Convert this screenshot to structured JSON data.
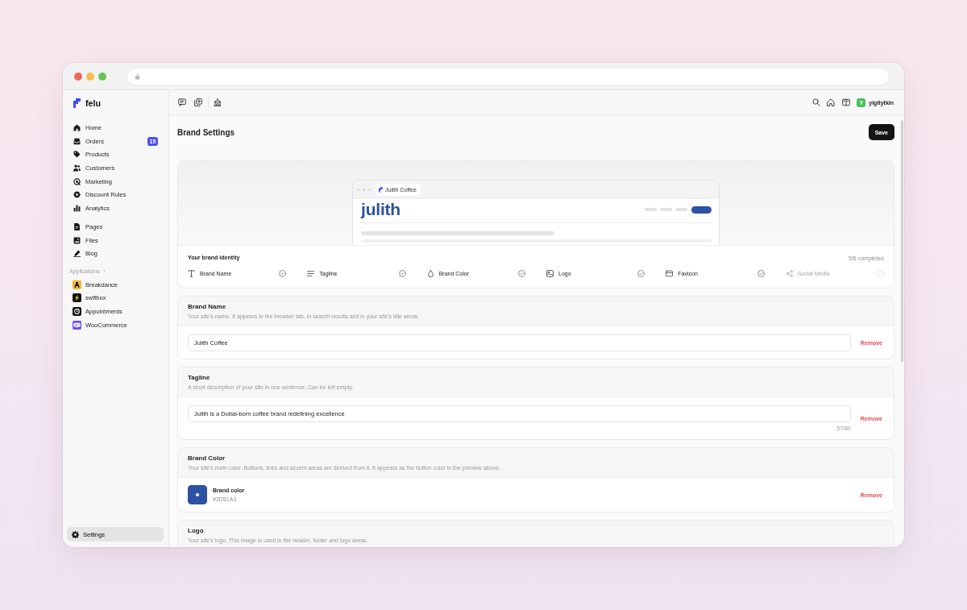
{
  "sidebar": {
    "brand": "felu",
    "primary_items": [
      {
        "label": "Home",
        "selected": false
      },
      {
        "label": "Orders",
        "badge": "15",
        "selected": false
      },
      {
        "label": "Products",
        "selected": false
      },
      {
        "label": "Customers",
        "selected": false
      },
      {
        "label": "Marketing",
        "selected": false
      },
      {
        "label": "Discount Rules",
        "selected": false
      },
      {
        "label": "Analytics",
        "selected": false
      }
    ],
    "content_items": [
      {
        "label": "Pages",
        "selected": false
      },
      {
        "label": "Files",
        "selected": false
      },
      {
        "label": "Blog",
        "selected": false
      }
    ],
    "applications": {
      "heading": "Applications",
      "items": [
        {
          "label": "Breakdance",
          "selected": false
        },
        {
          "label": "swftbox",
          "selected": false
        },
        {
          "label": "Appointments",
          "selected": false
        },
        {
          "label": "WooCommerce",
          "selected": false
        }
      ]
    },
    "footer_item": {
      "label": "Settings",
      "selected": true
    }
  },
  "topbar": {
    "user": {
      "initial": "Y",
      "name": "yigitytkin"
    }
  },
  "page": {
    "title": "Brand Settings",
    "save_button": "Save"
  },
  "preview": {
    "tab_title": "Julith Coffee",
    "logo_text": "julith"
  },
  "identity": {
    "title": "Your brand identity",
    "progress": "5/6 completed",
    "items": [
      {
        "label": "Brand Name",
        "completed": true
      },
      {
        "label": "Tagline",
        "completed": true
      },
      {
        "label": "Brand Color",
        "completed": true
      },
      {
        "label": "Logo",
        "completed": true
      },
      {
        "label": "Favicon",
        "completed": true
      },
      {
        "label": "Social Media",
        "completed": false
      }
    ]
  },
  "sections": [
    {
      "kind": "text",
      "title": "Brand Name",
      "description": "Your site's name. It appears in the browser tab, in search results and in your site's title areas.",
      "value": "Julith Coffee",
      "remove_label": "Remove"
    },
    {
      "kind": "text",
      "title": "Tagline",
      "description": "A short description of your site in one sentence. Can be left empty.",
      "value": "Julith is a Dubai-born coffee brand redefining excellence",
      "counter": "57/80",
      "remove_label": "Remove"
    },
    {
      "kind": "color",
      "title": "Brand Color",
      "description": "Your site's main color. Buttons, links and accent areas are derived from it. It appears as the button color in the preview above.",
      "swatch_label": "Brand color",
      "hex": "#2D51A3",
      "remove_label": "Remove"
    },
    {
      "kind": "image",
      "title": "Logo",
      "description": "Your site's logo. This image is used in the header, footer and logo areas."
    }
  ]
}
